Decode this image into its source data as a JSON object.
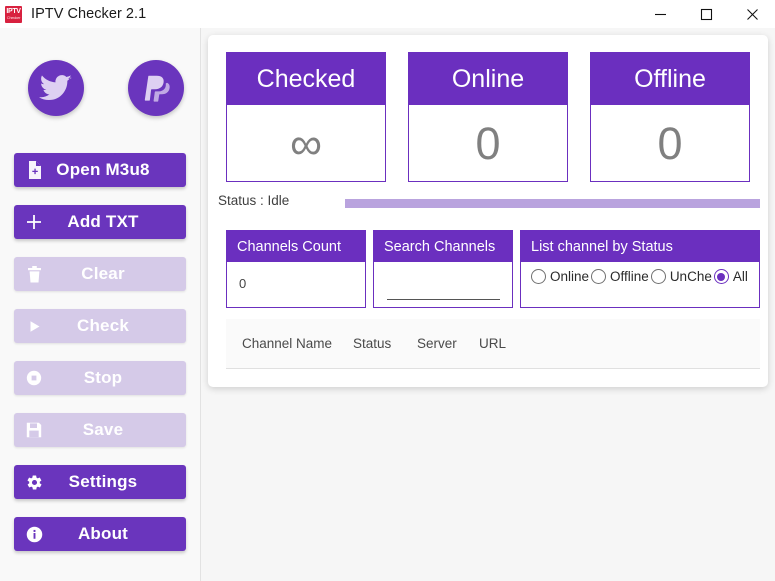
{
  "window": {
    "title": "IPTV Checker 2.1",
    "icon_line1": "IPTV",
    "icon_line2": "Checker",
    "minimize_label": "—",
    "maximize_label": "□",
    "close_label": "✕"
  },
  "sidebar": {
    "social": [
      {
        "name": "twitter",
        "label": "Twitter"
      },
      {
        "name": "paypal",
        "label": "PayPal"
      }
    ],
    "buttons": [
      {
        "label": "Open M3u8",
        "icon": "file-add-icon",
        "enabled": true
      },
      {
        "label": "Add TXT",
        "icon": "plus-icon",
        "enabled": true
      },
      {
        "label": "Clear",
        "icon": "trash-icon",
        "enabled": false
      },
      {
        "label": "Check",
        "icon": "play-icon",
        "enabled": false
      },
      {
        "label": "Stop",
        "icon": "stop-icon",
        "enabled": false
      },
      {
        "label": "Save",
        "icon": "save-icon",
        "enabled": false
      },
      {
        "label": "Settings",
        "icon": "gear-icon",
        "enabled": true
      },
      {
        "label": "About",
        "icon": "info-icon",
        "enabled": true
      }
    ]
  },
  "stats": {
    "cards": [
      {
        "title": "Checked",
        "value": "∞"
      },
      {
        "title": "Online",
        "value": "0"
      },
      {
        "title": "Offline",
        "value": "0"
      }
    ]
  },
  "status": {
    "label": "Status : Idle",
    "progress_percent": 100
  },
  "groups": {
    "channels_count": {
      "title": "Channels Count",
      "value": "0"
    },
    "search_channels": {
      "title": "Search Channels",
      "value": "",
      "placeholder": ""
    },
    "list_by_status": {
      "title": "List channel by Status",
      "options": [
        {
          "label": "Online",
          "selected": false
        },
        {
          "label": "Offline",
          "selected": false
        },
        {
          "label": "UnChe",
          "selected": false
        },
        {
          "label": "All",
          "selected": true
        }
      ]
    }
  },
  "table": {
    "columns": [
      "Channel Name",
      "Status",
      "Server",
      "URL"
    ],
    "rows": []
  },
  "colors": {
    "accent": "#6a35bd",
    "accent_header": "#6b2fbf",
    "disabled": "#d5cae8",
    "progress": "#b9a3de",
    "page_bg": "#f6f6f6",
    "icon_red": "#d8213f"
  }
}
